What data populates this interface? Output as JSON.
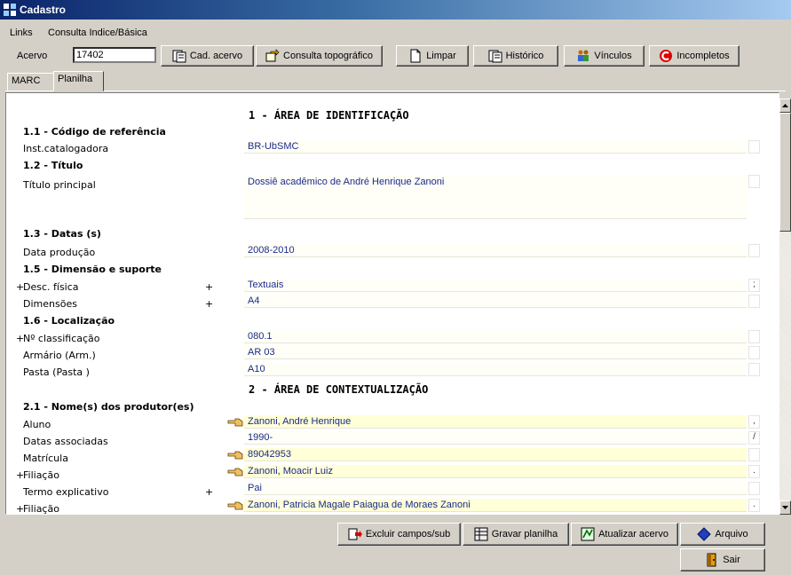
{
  "window": {
    "title": "Cadastro"
  },
  "menu": {
    "items": [
      "Links",
      "Consulta Indice/Básica"
    ]
  },
  "toolbar": {
    "acervo_label": "Acervo",
    "acervo_value": "17402",
    "buttons": [
      "Cad. acervo",
      "Consulta topográfico",
      "Limpar",
      "Histórico",
      "Vínculos",
      "Incompletos"
    ]
  },
  "tabs": [
    "MARC",
    "Planilha"
  ],
  "sheet": {
    "area1_title": "1 - ÁREA DE IDENTIFICAÇÃO",
    "area2_title": "2 - ÁREA DE CONTEXTUALIZAÇÃO",
    "sections": {
      "s11": "1.1 - Código de referência",
      "s12": "1.2 - Título",
      "s13": "1.3 - Datas (s)",
      "s15": "1.5 - Dimensão e suporte",
      "s16": "1.6 - Localização",
      "s21": "2.1 - Nome(s) dos produtor(es)"
    },
    "rows": {
      "inst": {
        "label": "Inst.catalogadora",
        "value": "BR-UbSMC"
      },
      "titulo": {
        "label": "Título principal",
        "value": "Dossiê acadêmico de André Henrique Zanoni"
      },
      "data": {
        "label": "Data produção",
        "value": "2008-2010"
      },
      "desc": {
        "label": "Desc. física",
        "value": "Textuais",
        "side": ";"
      },
      "dim": {
        "label": "Dimensões",
        "value": "A4"
      },
      "classif": {
        "label": "Nº classificação",
        "value": "080.1"
      },
      "armario": {
        "label": "Armário (Arm.)",
        "value": "AR 03"
      },
      "pasta": {
        "label": "Pasta (Pasta )",
        "value": "A10"
      },
      "aluno": {
        "label": "Aluno",
        "value": "Zanoni, André Henrique",
        "side": ","
      },
      "datas_assoc": {
        "label": "Datas associadas",
        "value": "1990-",
        "side": "/"
      },
      "matricula": {
        "label": "Matrícula",
        "value": "89042953"
      },
      "filiacao1": {
        "label": "Filiação",
        "value": "Zanoni, Moacir Luiz",
        "side": "."
      },
      "termo": {
        "label": "Termo explicativo",
        "value": "Pai"
      },
      "filiacao2": {
        "label": "Filiação",
        "value": "Zanoni, Patricia Magale Paiagua de Moraes Zanoni",
        "side": "."
      }
    },
    "plus": "+"
  },
  "bottom": {
    "excluir": "Excluir campos/sub",
    "gravar": "Gravar planilha",
    "atualizar": "Atualizar acervo",
    "arquivo": "Arquivo",
    "sair": "Sair"
  },
  "colors": {
    "title_start": "#0a246a",
    "field_bg": "#fffff8",
    "field_highlight": "#ffffd8",
    "field_text": "#1a2a8a"
  }
}
